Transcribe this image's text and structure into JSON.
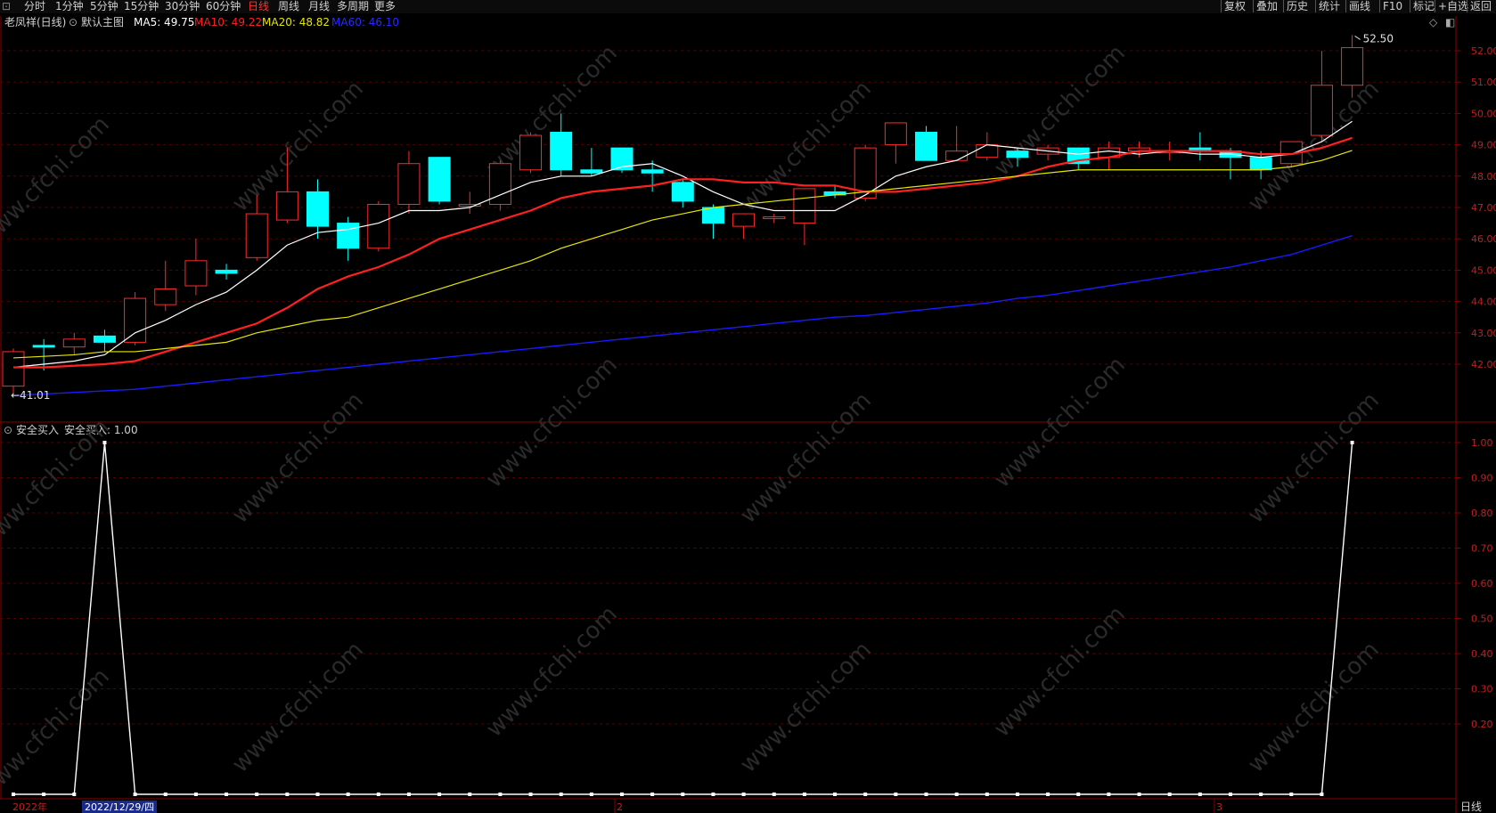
{
  "toolbar": {
    "periods": [
      "分时",
      "1分钟",
      "5分钟",
      "15分钟",
      "30分钟",
      "60分钟",
      "日线",
      "周线",
      "月线",
      "多周期",
      "更多"
    ],
    "active": "日线",
    "right": [
      "复权",
      "叠加",
      "历史",
      "统计",
      "画线",
      "F10",
      "标记",
      "+自选",
      "返回"
    ]
  },
  "info": {
    "stock": "老凤祥(日线)",
    "template": "默认主图",
    "ma5": "MA5: 49.75",
    "ma10": "MA10: 49.22",
    "ma20": "MA20: 48.82",
    "ma60": "MA60: 46.10"
  },
  "indicator": {
    "title": "安全买入",
    "value": "安全买入: 1.00"
  },
  "bottom": {
    "year": "2022年",
    "cursor_date": "2022/12/29/四",
    "m2": "2",
    "m3": "3",
    "period": "日线"
  },
  "watermark": "www.cfchi.com",
  "colors": {
    "up": "#ff2a2a",
    "down": "#00ffff",
    "ma5": "#ffffff",
    "ma10": "#ff2020",
    "ma20": "#e6e600",
    "ma60": "#1a1aff",
    "grid": "#5a0000"
  },
  "chart_data": [
    {
      "type": "candlestick",
      "title": "老凤祥(日线)",
      "y_ticks": [
        "52.00",
        "51.00",
        "50.00",
        "49.00",
        "48.00",
        "47.00",
        "46.00",
        "45.00",
        "44.00",
        "43.00",
        "42.00"
      ],
      "ylim": [
        40.6,
        52.9
      ],
      "labels": {
        "high": "52.50",
        "low": "41.01"
      },
      "candles": [
        {
          "o": 41.3,
          "h": 42.5,
          "l": 41.01,
          "c": 42.4
        },
        {
          "o": 42.6,
          "h": 42.8,
          "l": 41.8,
          "c": 42.55
        },
        {
          "o": 42.55,
          "h": 43.0,
          "l": 42.3,
          "c": 42.8
        },
        {
          "o": 42.9,
          "h": 43.1,
          "l": 42.4,
          "c": 42.7
        },
        {
          "o": 42.7,
          "h": 44.3,
          "l": 42.6,
          "c": 44.1
        },
        {
          "o": 43.9,
          "h": 45.3,
          "l": 43.7,
          "c": 44.4
        },
        {
          "o": 44.5,
          "h": 46.0,
          "l": 44.2,
          "c": 45.3
        },
        {
          "o": 45.0,
          "h": 45.2,
          "l": 44.7,
          "c": 44.9
        },
        {
          "o": 45.4,
          "h": 47.4,
          "l": 45.3,
          "c": 46.8
        },
        {
          "o": 46.6,
          "h": 48.9,
          "l": 46.5,
          "c": 47.5
        },
        {
          "o": 47.5,
          "h": 47.9,
          "l": 46.0,
          "c": 46.4
        },
        {
          "o": 46.5,
          "h": 46.7,
          "l": 45.3,
          "c": 45.7
        },
        {
          "o": 45.7,
          "h": 47.2,
          "l": 45.6,
          "c": 47.1
        },
        {
          "o": 47.1,
          "h": 48.8,
          "l": 46.8,
          "c": 48.4
        },
        {
          "o": 48.6,
          "h": 48.6,
          "l": 47.1,
          "c": 47.2
        },
        {
          "o": 47.1,
          "h": 47.5,
          "l": 46.8,
          "c": 47.1
        },
        {
          "o": 47.1,
          "h": 48.5,
          "l": 46.9,
          "c": 48.4
        },
        {
          "o": 48.2,
          "h": 49.4,
          "l": 48.1,
          "c": 49.3
        },
        {
          "o": 49.4,
          "h": 50.0,
          "l": 48.0,
          "c": 48.2
        },
        {
          "o": 48.2,
          "h": 48.9,
          "l": 48.0,
          "c": 48.1
        },
        {
          "o": 48.9,
          "h": 48.9,
          "l": 48.1,
          "c": 48.2
        },
        {
          "o": 48.2,
          "h": 48.5,
          "l": 47.5,
          "c": 48.1
        },
        {
          "o": 47.8,
          "h": 47.9,
          "l": 47.0,
          "c": 47.2
        },
        {
          "o": 47.0,
          "h": 47.1,
          "l": 46.0,
          "c": 46.5
        },
        {
          "o": 46.4,
          "h": 46.8,
          "l": 46.0,
          "c": 46.8
        },
        {
          "o": 46.7,
          "h": 46.8,
          "l": 46.5,
          "c": 46.7
        },
        {
          "o": 46.5,
          "h": 47.6,
          "l": 45.8,
          "c": 47.6
        },
        {
          "o": 47.5,
          "h": 47.7,
          "l": 47.3,
          "c": 47.4
        },
        {
          "o": 47.3,
          "h": 49.0,
          "l": 47.2,
          "c": 48.9
        },
        {
          "o": 49.0,
          "h": 49.7,
          "l": 48.4,
          "c": 49.7
        },
        {
          "o": 49.4,
          "h": 49.6,
          "l": 48.5,
          "c": 48.5
        },
        {
          "o": 48.5,
          "h": 49.6,
          "l": 48.5,
          "c": 48.8
        },
        {
          "o": 48.6,
          "h": 49.4,
          "l": 48.5,
          "c": 49.0
        },
        {
          "o": 48.8,
          "h": 48.9,
          "l": 48.3,
          "c": 48.6
        },
        {
          "o": 48.7,
          "h": 49.0,
          "l": 48.5,
          "c": 48.9
        },
        {
          "o": 48.9,
          "h": 48.9,
          "l": 48.2,
          "c": 48.4
        },
        {
          "o": 48.6,
          "h": 49.1,
          "l": 48.2,
          "c": 48.9
        },
        {
          "o": 48.8,
          "h": 49.1,
          "l": 48.6,
          "c": 48.9
        },
        {
          "o": 48.8,
          "h": 49.1,
          "l": 48.5,
          "c": 48.8
        },
        {
          "o": 48.9,
          "h": 49.4,
          "l": 48.5,
          "c": 48.8
        },
        {
          "o": 48.8,
          "h": 48.9,
          "l": 47.9,
          "c": 48.6
        },
        {
          "o": 48.6,
          "h": 48.8,
          "l": 47.9,
          "c": 48.2
        },
        {
          "o": 48.4,
          "h": 49.1,
          "l": 48.3,
          "c": 49.1
        },
        {
          "o": 49.3,
          "h": 52.0,
          "l": 49.1,
          "c": 50.9
        },
        {
          "o": 50.9,
          "h": 52.5,
          "l": 50.5,
          "c": 52.1
        }
      ],
      "series": [
        {
          "name": "MA5",
          "values": [
            41.9,
            42.0,
            42.1,
            42.3,
            43.0,
            43.4,
            43.9,
            44.3,
            45.0,
            45.8,
            46.2,
            46.3,
            46.5,
            46.9,
            46.9,
            47.0,
            47.4,
            47.8,
            48.0,
            48.0,
            48.3,
            48.4,
            48.0,
            47.5,
            47.1,
            46.9,
            46.9,
            46.9,
            47.4,
            48.0,
            48.3,
            48.5,
            49.0,
            48.9,
            48.8,
            48.7,
            48.8,
            48.7,
            48.8,
            48.7,
            48.7,
            48.6,
            48.7,
            49.1,
            49.75
          ]
        },
        {
          "name": "MA10",
          "values": [
            41.9,
            41.9,
            41.95,
            42.0,
            42.1,
            42.4,
            42.7,
            43.0,
            43.3,
            43.8,
            44.4,
            44.8,
            45.1,
            45.5,
            46.0,
            46.3,
            46.6,
            46.9,
            47.3,
            47.5,
            47.6,
            47.7,
            47.9,
            47.9,
            47.8,
            47.8,
            47.7,
            47.7,
            47.5,
            47.5,
            47.6,
            47.7,
            47.8,
            48.0,
            48.3,
            48.5,
            48.6,
            48.8,
            48.8,
            48.8,
            48.8,
            48.7,
            48.7,
            48.9,
            49.22
          ]
        },
        {
          "name": "MA20",
          "values": [
            42.2,
            42.25,
            42.3,
            42.4,
            42.4,
            42.5,
            42.6,
            42.7,
            43.0,
            43.2,
            43.4,
            43.5,
            43.8,
            44.1,
            44.4,
            44.7,
            45.0,
            45.3,
            45.7,
            46.0,
            46.3,
            46.6,
            46.8,
            47.0,
            47.1,
            47.2,
            47.3,
            47.4,
            47.5,
            47.6,
            47.7,
            47.8,
            47.9,
            48.0,
            48.1,
            48.2,
            48.2,
            48.2,
            48.2,
            48.2,
            48.2,
            48.2,
            48.3,
            48.5,
            48.82
          ]
        },
        {
          "name": "MA60",
          "values": [
            41.0,
            41.05,
            41.1,
            41.15,
            41.2,
            41.3,
            41.4,
            41.5,
            41.6,
            41.7,
            41.8,
            41.9,
            42.0,
            42.1,
            42.2,
            42.3,
            42.4,
            42.5,
            42.6,
            42.7,
            42.8,
            42.9,
            43.0,
            43.1,
            43.2,
            43.3,
            43.4,
            43.5,
            43.55,
            43.65,
            43.75,
            43.85,
            43.95,
            44.1,
            44.2,
            44.35,
            44.5,
            44.65,
            44.8,
            44.95,
            45.1,
            45.3,
            45.5,
            45.8,
            46.1
          ]
        }
      ]
    },
    {
      "type": "line",
      "title": "安全买入",
      "y_ticks": [
        "1.00",
        "0.90",
        "0.80",
        "0.70",
        "0.60",
        "0.50",
        "0.40",
        "0.30",
        "0.20"
      ],
      "ylim": [
        0,
        1
      ],
      "series": [
        {
          "name": "安全买入",
          "values": [
            0,
            0,
            0,
            1,
            0,
            0,
            0,
            0,
            0,
            0,
            0,
            0,
            0,
            0,
            0,
            0,
            0,
            0,
            0,
            0,
            0,
            0,
            0,
            0,
            0,
            0,
            0,
            0,
            0,
            0,
            0,
            0,
            0,
            0,
            0,
            0,
            0,
            0,
            0,
            0,
            0,
            0,
            0,
            0,
            1
          ]
        }
      ]
    }
  ]
}
